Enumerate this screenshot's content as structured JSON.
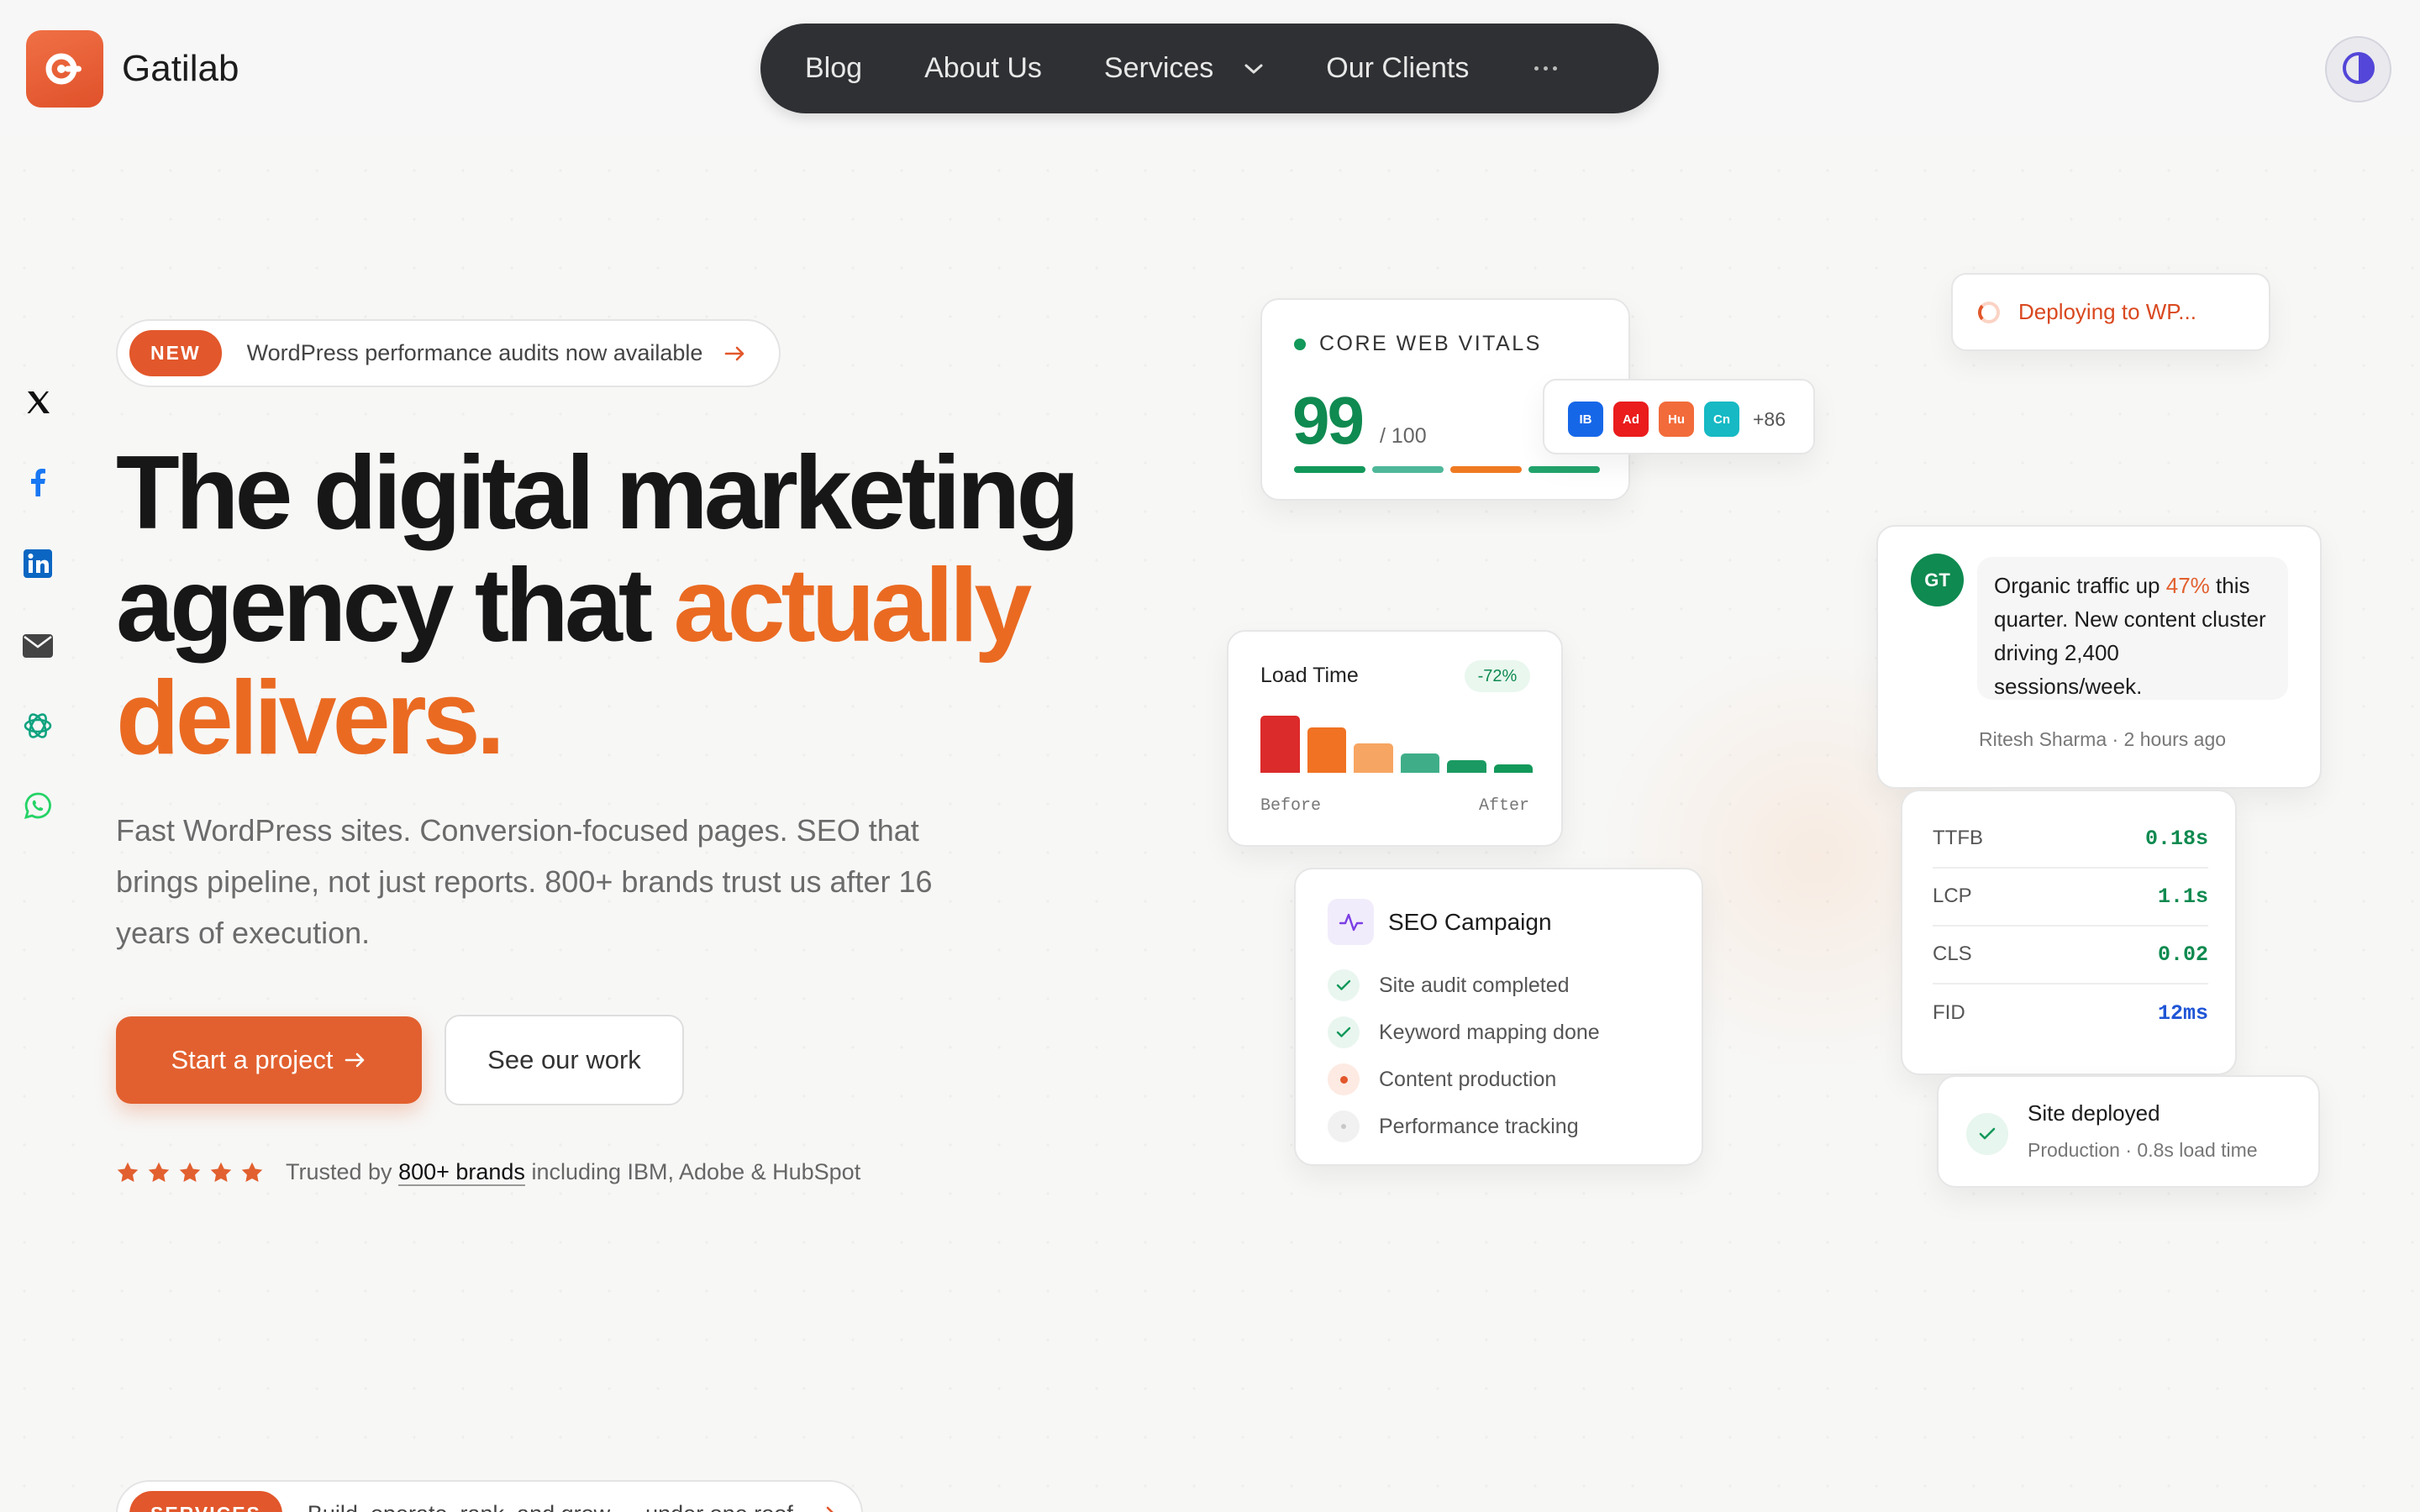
{
  "brand": {
    "name": "Gatilab",
    "color": "#e2572b"
  },
  "nav": {
    "items": [
      "Blog",
      "About Us",
      "Services",
      "Our Clients"
    ],
    "more_icon": "ellipsis-icon"
  },
  "theme_toggle": {
    "icon": "contrast-icon"
  },
  "social": [
    "x-icon",
    "facebook-icon",
    "linkedin-icon",
    "email-icon",
    "openai-icon",
    "whatsapp-icon"
  ],
  "announcement": {
    "badge": "NEW",
    "text": "WordPress performance audits now available"
  },
  "hero": {
    "line1": "The digital marketing",
    "line2_a": "agency that ",
    "line2_b": "actually",
    "line3": "delivers.",
    "subtitle": "Fast WordPress sites. Conversion-focused pages. SEO that brings pipeline, not just reports. 800+ brands trust us after 16 years of execution."
  },
  "cta": {
    "primary": "Start a project",
    "secondary": "See our work"
  },
  "trust": {
    "rating": 5,
    "prefix": "Trusted by ",
    "link": "800+ brands",
    "suffix": " including IBM, Adobe & HubSpot"
  },
  "core_web_vitals": {
    "label": "CORE WEB VITALS",
    "score": "99",
    "max": "/ 100",
    "bar_colors": [
      "#12985a",
      "#4fb89a",
      "#ef7a22",
      "#23a46d"
    ]
  },
  "clients": {
    "avatars": [
      {
        "text": "IB",
        "color": "#1667e8"
      },
      {
        "text": "Ad",
        "color": "#ea1c1c"
      },
      {
        "text": "Hu",
        "color": "#f26b3a"
      },
      {
        "text": "Cn",
        "color": "#16b9c4"
      }
    ],
    "more": "+86"
  },
  "deploying": {
    "text": "Deploying to WP..."
  },
  "review": {
    "initials": "GT",
    "text_a": "Organic traffic up ",
    "highlight": "47%",
    "text_b": " this quarter. New content cluster driving 2,400 sessions/week.",
    "meta": "Ritesh Sharma · 2 hours ago"
  },
  "load_time": {
    "title": "Load Time",
    "badge": "-72%",
    "before": "Before",
    "after": "After",
    "values": [
      100,
      80,
      52,
      34,
      22,
      15
    ],
    "colors": [
      "#dc2b2b",
      "#f07222",
      "#f7a562",
      "#3fae88",
      "#1a9a62",
      "#12985a"
    ]
  },
  "seo_campaign": {
    "title": "SEO Campaign",
    "items": [
      {
        "label": "Site audit completed",
        "status": "done"
      },
      {
        "label": "Keyword mapping done",
        "status": "done"
      },
      {
        "label": "Content production",
        "status": "active"
      },
      {
        "label": "Performance tracking",
        "status": "pending"
      }
    ]
  },
  "metrics": [
    {
      "name": "TTFB",
      "value": "0.18s",
      "color": "#0f8a50"
    },
    {
      "name": "LCP",
      "value": "1.1s",
      "color": "#0f8a50"
    },
    {
      "name": "CLS",
      "value": "0.02",
      "color": "#0f8a50"
    },
    {
      "name": "FID",
      "value": "12ms",
      "color": "#1f55d6"
    }
  ],
  "deployed": {
    "title": "Site deployed",
    "subtitle": "Production · 0.8s load time"
  },
  "services_pill": {
    "badge": "SERVICES",
    "text": "Build, operate, rank, and grow — under one roof"
  }
}
